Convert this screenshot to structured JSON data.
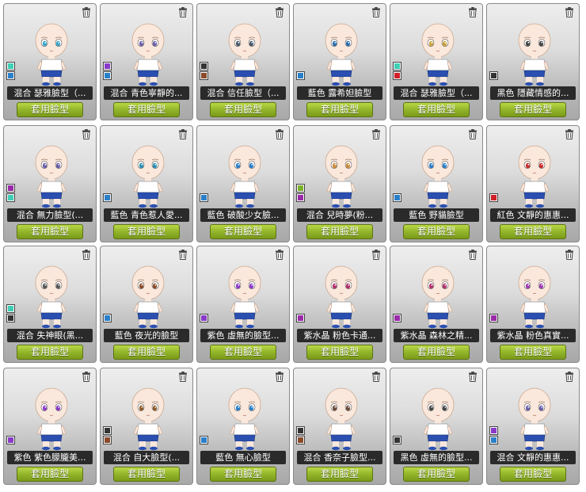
{
  "apply_label": "套用臉型",
  "cards": [
    {
      "name": "混合  瑟雅臉型（...",
      "eye": "#3aa6c9",
      "swatches": [
        "#3ecfb5",
        "#2a7fc9"
      ]
    },
    {
      "name": "混合  青色寧靜的...",
      "eye": "#6b5ea8",
      "swatches": [
        "#8a3ac9",
        "#2a7fc9"
      ]
    },
    {
      "name": "混合  信任臉型（...",
      "eye": "#4a5a6a",
      "swatches": [
        "#333333",
        "#8a4a2a"
      ]
    },
    {
      "name": "藍色  露希妲臉型",
      "eye": "#2a6fb0",
      "swatches": [
        "#2a7fc9"
      ]
    },
    {
      "name": "混合  瑟雅臉型（...",
      "eye": "#c9a23a",
      "swatches": [
        "#3ecfb5",
        "#d0202a"
      ]
    },
    {
      "name": "黑色  隱藏情感的...",
      "eye": "#444444",
      "swatches": [
        "#333333"
      ]
    },
    {
      "name": "混合  無力臉型(...",
      "eye": "#6b5ea8",
      "swatches": [
        "#9a2aa8",
        "#3ecfb5"
      ]
    },
    {
      "name": "藍色  青色惹人愛...",
      "eye": "#2a8fb0",
      "swatches": [
        "#2a7fc9"
      ]
    },
    {
      "name": "藍色  破酸少女臉...",
      "eye": "#2a7fc9",
      "swatches": [
        "#2a7fc9"
      ]
    },
    {
      "name": "混合  兒時夢(粉...",
      "eye": "#c98a3a",
      "swatches": [
        "#7ab02a",
        "#9a2aa8"
      ]
    },
    {
      "name": "藍色  野貓臉型",
      "eye": "#2a7fc9",
      "swatches": [
        "#2a7fc9"
      ]
    },
    {
      "name": "紅色  文靜的惠惠...",
      "eye": "#c92a2a",
      "swatches": [
        "#d0202a"
      ]
    },
    {
      "name": "混合  失神眼(黑...",
      "eye": "#555555",
      "swatches": [
        "#3ecfb5",
        "#333333"
      ]
    },
    {
      "name": "藍色  夜光的臉型",
      "eye": "#8a4a2a",
      "swatches": [
        "#2a7fc9"
      ]
    },
    {
      "name": "紫色  虛無的臉型...",
      "eye": "#8a3ac9",
      "swatches": [
        "#8a3ac9"
      ]
    },
    {
      "name": "紫水晶  粉色卡通...",
      "eye": "#b0306a",
      "swatches": [
        "#9a2aa8"
      ]
    },
    {
      "name": "紫水晶  森林之精...",
      "eye": "#b0306a",
      "swatches": [
        "#9a2aa8"
      ]
    },
    {
      "name": "紫水晶  粉色真實...",
      "eye": "#9a3ab0",
      "swatches": [
        "#9a2aa8"
      ]
    },
    {
      "name": "紫色  紫色朦朧美...",
      "eye": "#8a3ac9",
      "swatches": [
        "#8a3ac9"
      ]
    },
    {
      "name": "混合  自大臉型(...",
      "eye": "#8a5a2a",
      "swatches": [
        "#333333",
        "#8a4a2a"
      ]
    },
    {
      "name": "藍色  無心臉型",
      "eye": "#2a7fc9",
      "swatches": [
        "#2a7fc9"
      ]
    },
    {
      "name": "混合  香奈子臉型...",
      "eye": "#6a4a3a",
      "swatches": [
        "#333333",
        "#8a4a2a"
      ]
    },
    {
      "name": "黑色  虛無的臉型...",
      "eye": "#444444",
      "swatches": [
        "#333333"
      ]
    },
    {
      "name": "混合  文靜的惠惠...",
      "eye": "#6b5ea8",
      "swatches": [
        "#8a3ac9",
        "#2a7fc9"
      ]
    }
  ]
}
